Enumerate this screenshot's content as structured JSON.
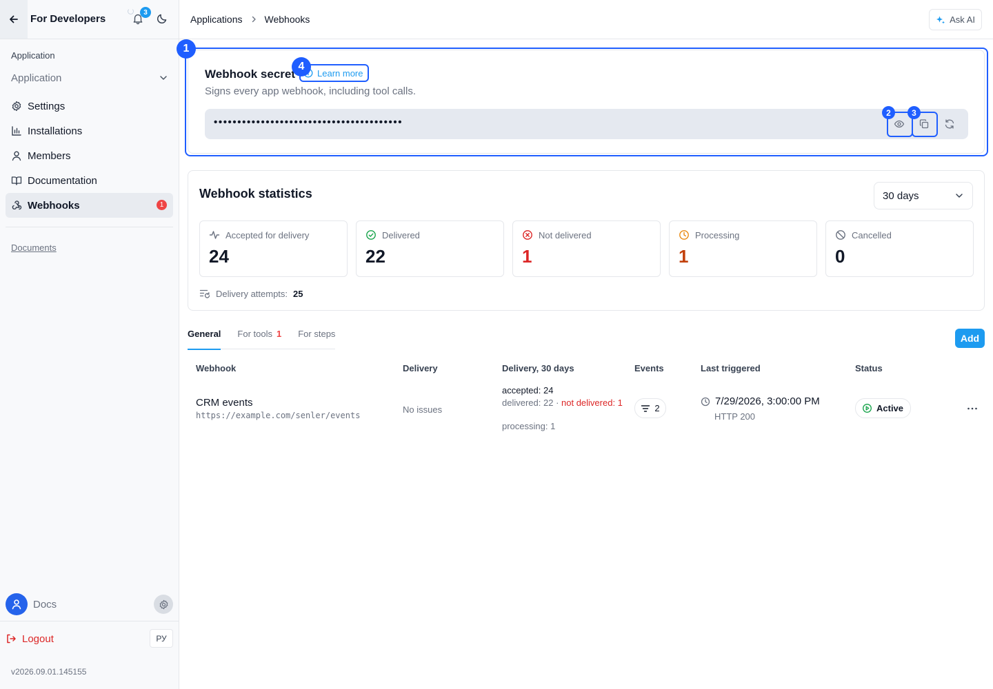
{
  "sidebar": {
    "title": "For Developers",
    "notification_count": "3",
    "section_label": "Application",
    "app_select": "Application",
    "nav": [
      {
        "label": "Settings",
        "icon": "gear-icon"
      },
      {
        "label": "Installations",
        "icon": "chart-bars-icon"
      },
      {
        "label": "Members",
        "icon": "user-icon"
      },
      {
        "label": "Documentation",
        "icon": "book-icon"
      },
      {
        "label": "Webhooks",
        "icon": "webhook-icon",
        "badge": "1",
        "active": true
      }
    ],
    "documents_link": "Documents",
    "user_name": "Docs",
    "logout_label": "Logout",
    "language": "РУ",
    "version": "v2026.09.01.145155"
  },
  "topbar": {
    "breadcrumb": [
      "Applications",
      "Webhooks"
    ],
    "ask_ai": "Ask AI"
  },
  "secret": {
    "title": "Webhook secret",
    "learn_more": "Learn more",
    "subtitle": "Signs every app webhook, including tool calls.",
    "masked_value": "••••••••••••••••••••••••••••••••••••••••"
  },
  "stats": {
    "title": "Webhook statistics",
    "period": "30 days",
    "cards": [
      {
        "label": "Accepted for delivery",
        "value": "24",
        "icon": "activity-icon",
        "color": "#111827"
      },
      {
        "label": "Delivered",
        "value": "22",
        "icon": "check-circle-icon",
        "color": "#111827"
      },
      {
        "label": "Not delivered",
        "value": "1",
        "icon": "x-circle-icon",
        "color": "#dc2626"
      },
      {
        "label": "Processing",
        "value": "1",
        "icon": "clock-icon",
        "color": "#c2410c"
      },
      {
        "label": "Cancelled",
        "value": "0",
        "icon": "ban-icon",
        "color": "#111827"
      }
    ],
    "attempts_label": "Delivery attempts:",
    "attempts_value": "25"
  },
  "tabs": [
    {
      "label": "General",
      "active": true
    },
    {
      "label": "For tools",
      "count": "1"
    },
    {
      "label": "For steps"
    }
  ],
  "add_label": "Add",
  "table": {
    "headers": [
      "Webhook",
      "Delivery",
      "Delivery, 30 days",
      "Events",
      "Last triggered",
      "Status"
    ],
    "rows": [
      {
        "name": "CRM events",
        "url": "https://example.com/senler/events",
        "delivery": "No issues",
        "accepted": "accepted: 24",
        "delivered": "delivered: 22",
        "not_delivered": "not delivered: 1",
        "processing": "processing: 1",
        "events": "2",
        "last_triggered": "7/29/2026, 3:00:00 PM",
        "http": "HTTP 200",
        "status": "Active"
      }
    ]
  },
  "annotations": [
    "1",
    "2",
    "3",
    "4"
  ],
  "colors": {
    "accent": "#1d9bf0",
    "annotation": "#1f5eff",
    "danger": "#dc2626",
    "warning": "#c2410c",
    "success": "#16a34a"
  }
}
